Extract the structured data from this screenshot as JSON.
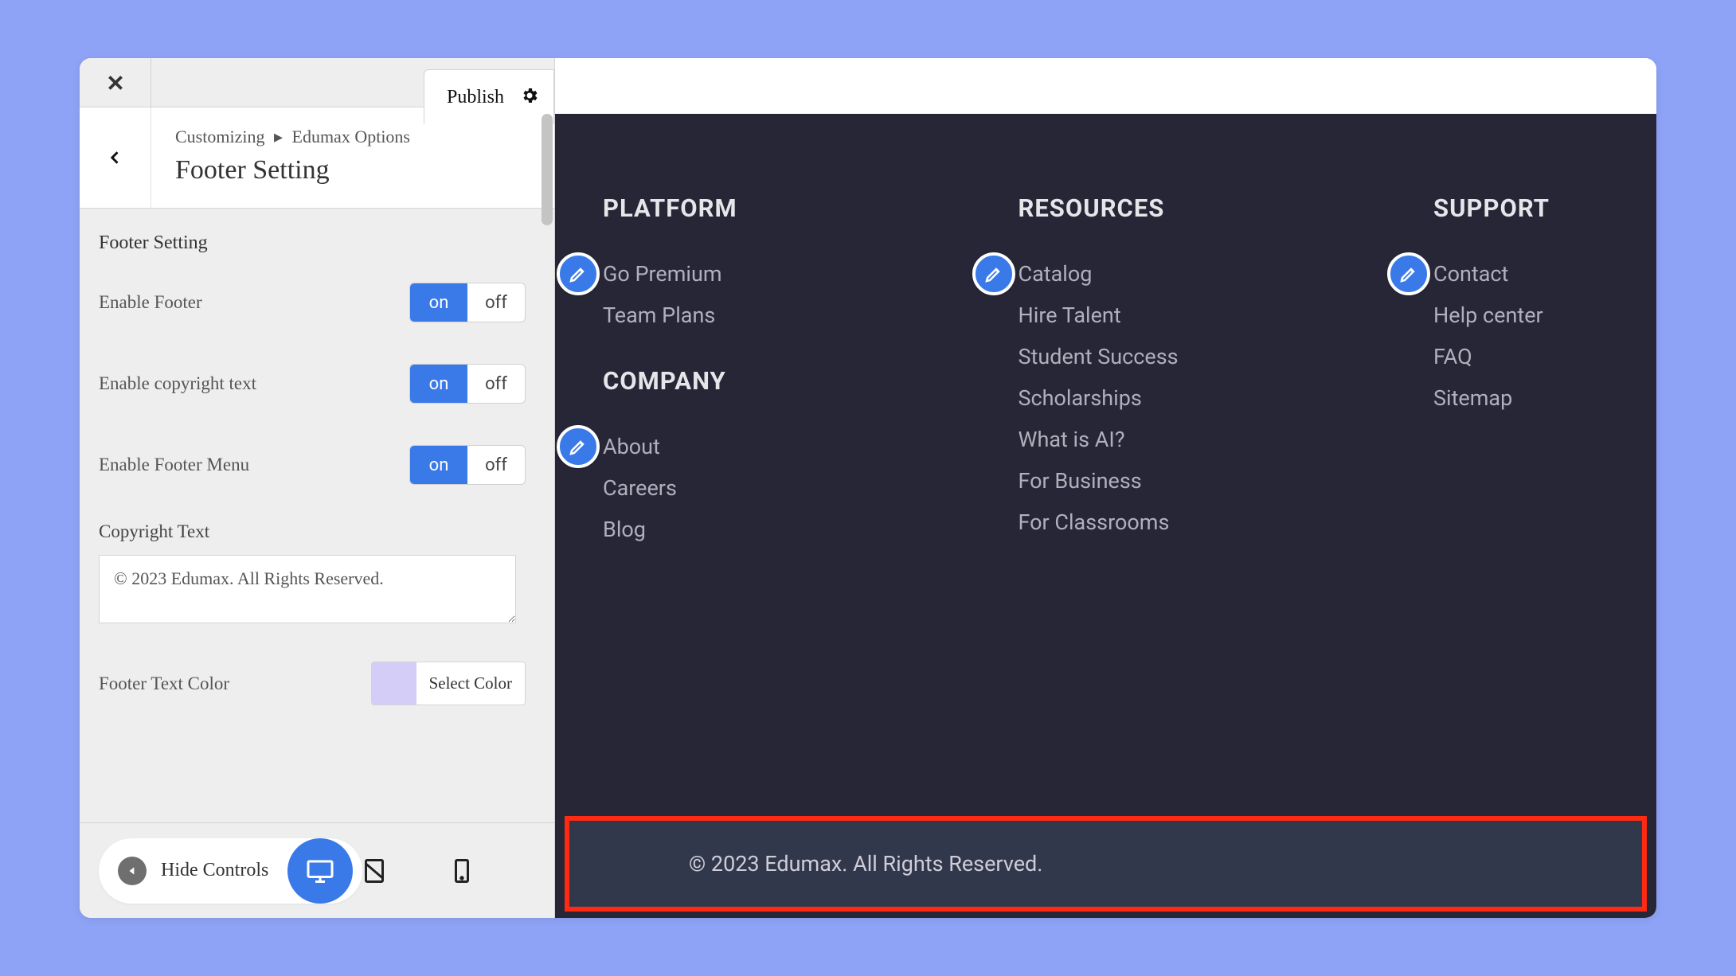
{
  "sidebar": {
    "publish": "Publish",
    "breadcrumb": {
      "parent": "Customizing",
      "child": "Edumax Options"
    },
    "title": "Footer Setting",
    "section_title": "Footer Setting",
    "toggles": [
      {
        "label": "Enable Footer",
        "on": "on",
        "off": "off"
      },
      {
        "label": "Enable copyright text",
        "on": "on",
        "off": "off"
      },
      {
        "label": "Enable Footer Menu",
        "on": "on",
        "off": "off"
      }
    ],
    "copyright_label": "Copyright Text",
    "copyright_value": "© 2023 Edumax. All Rights Reserved.",
    "color_label": "Footer Text Color",
    "select_color": "Select Color",
    "swatch_color": "#d3cdf7",
    "hide_controls": "Hide Controls"
  },
  "footer": {
    "columns": [
      {
        "heading": "PLATFORM",
        "links": [
          "Go Premium",
          "Team Plans"
        ],
        "second_heading": "COMPANY",
        "second_links": [
          "About",
          "Careers",
          "Blog"
        ]
      },
      {
        "heading": "RESOURCES",
        "links": [
          "Catalog",
          "Hire Talent",
          "Student Success",
          "Scholarships",
          "What is AI?",
          "For Business",
          "For Classrooms"
        ]
      },
      {
        "heading": "SUPPORT",
        "links": [
          "Contact",
          "Help center",
          "FAQ",
          "Sitemap"
        ]
      }
    ],
    "copyright": "© 2023 Edumax. All Rights Reserved."
  }
}
